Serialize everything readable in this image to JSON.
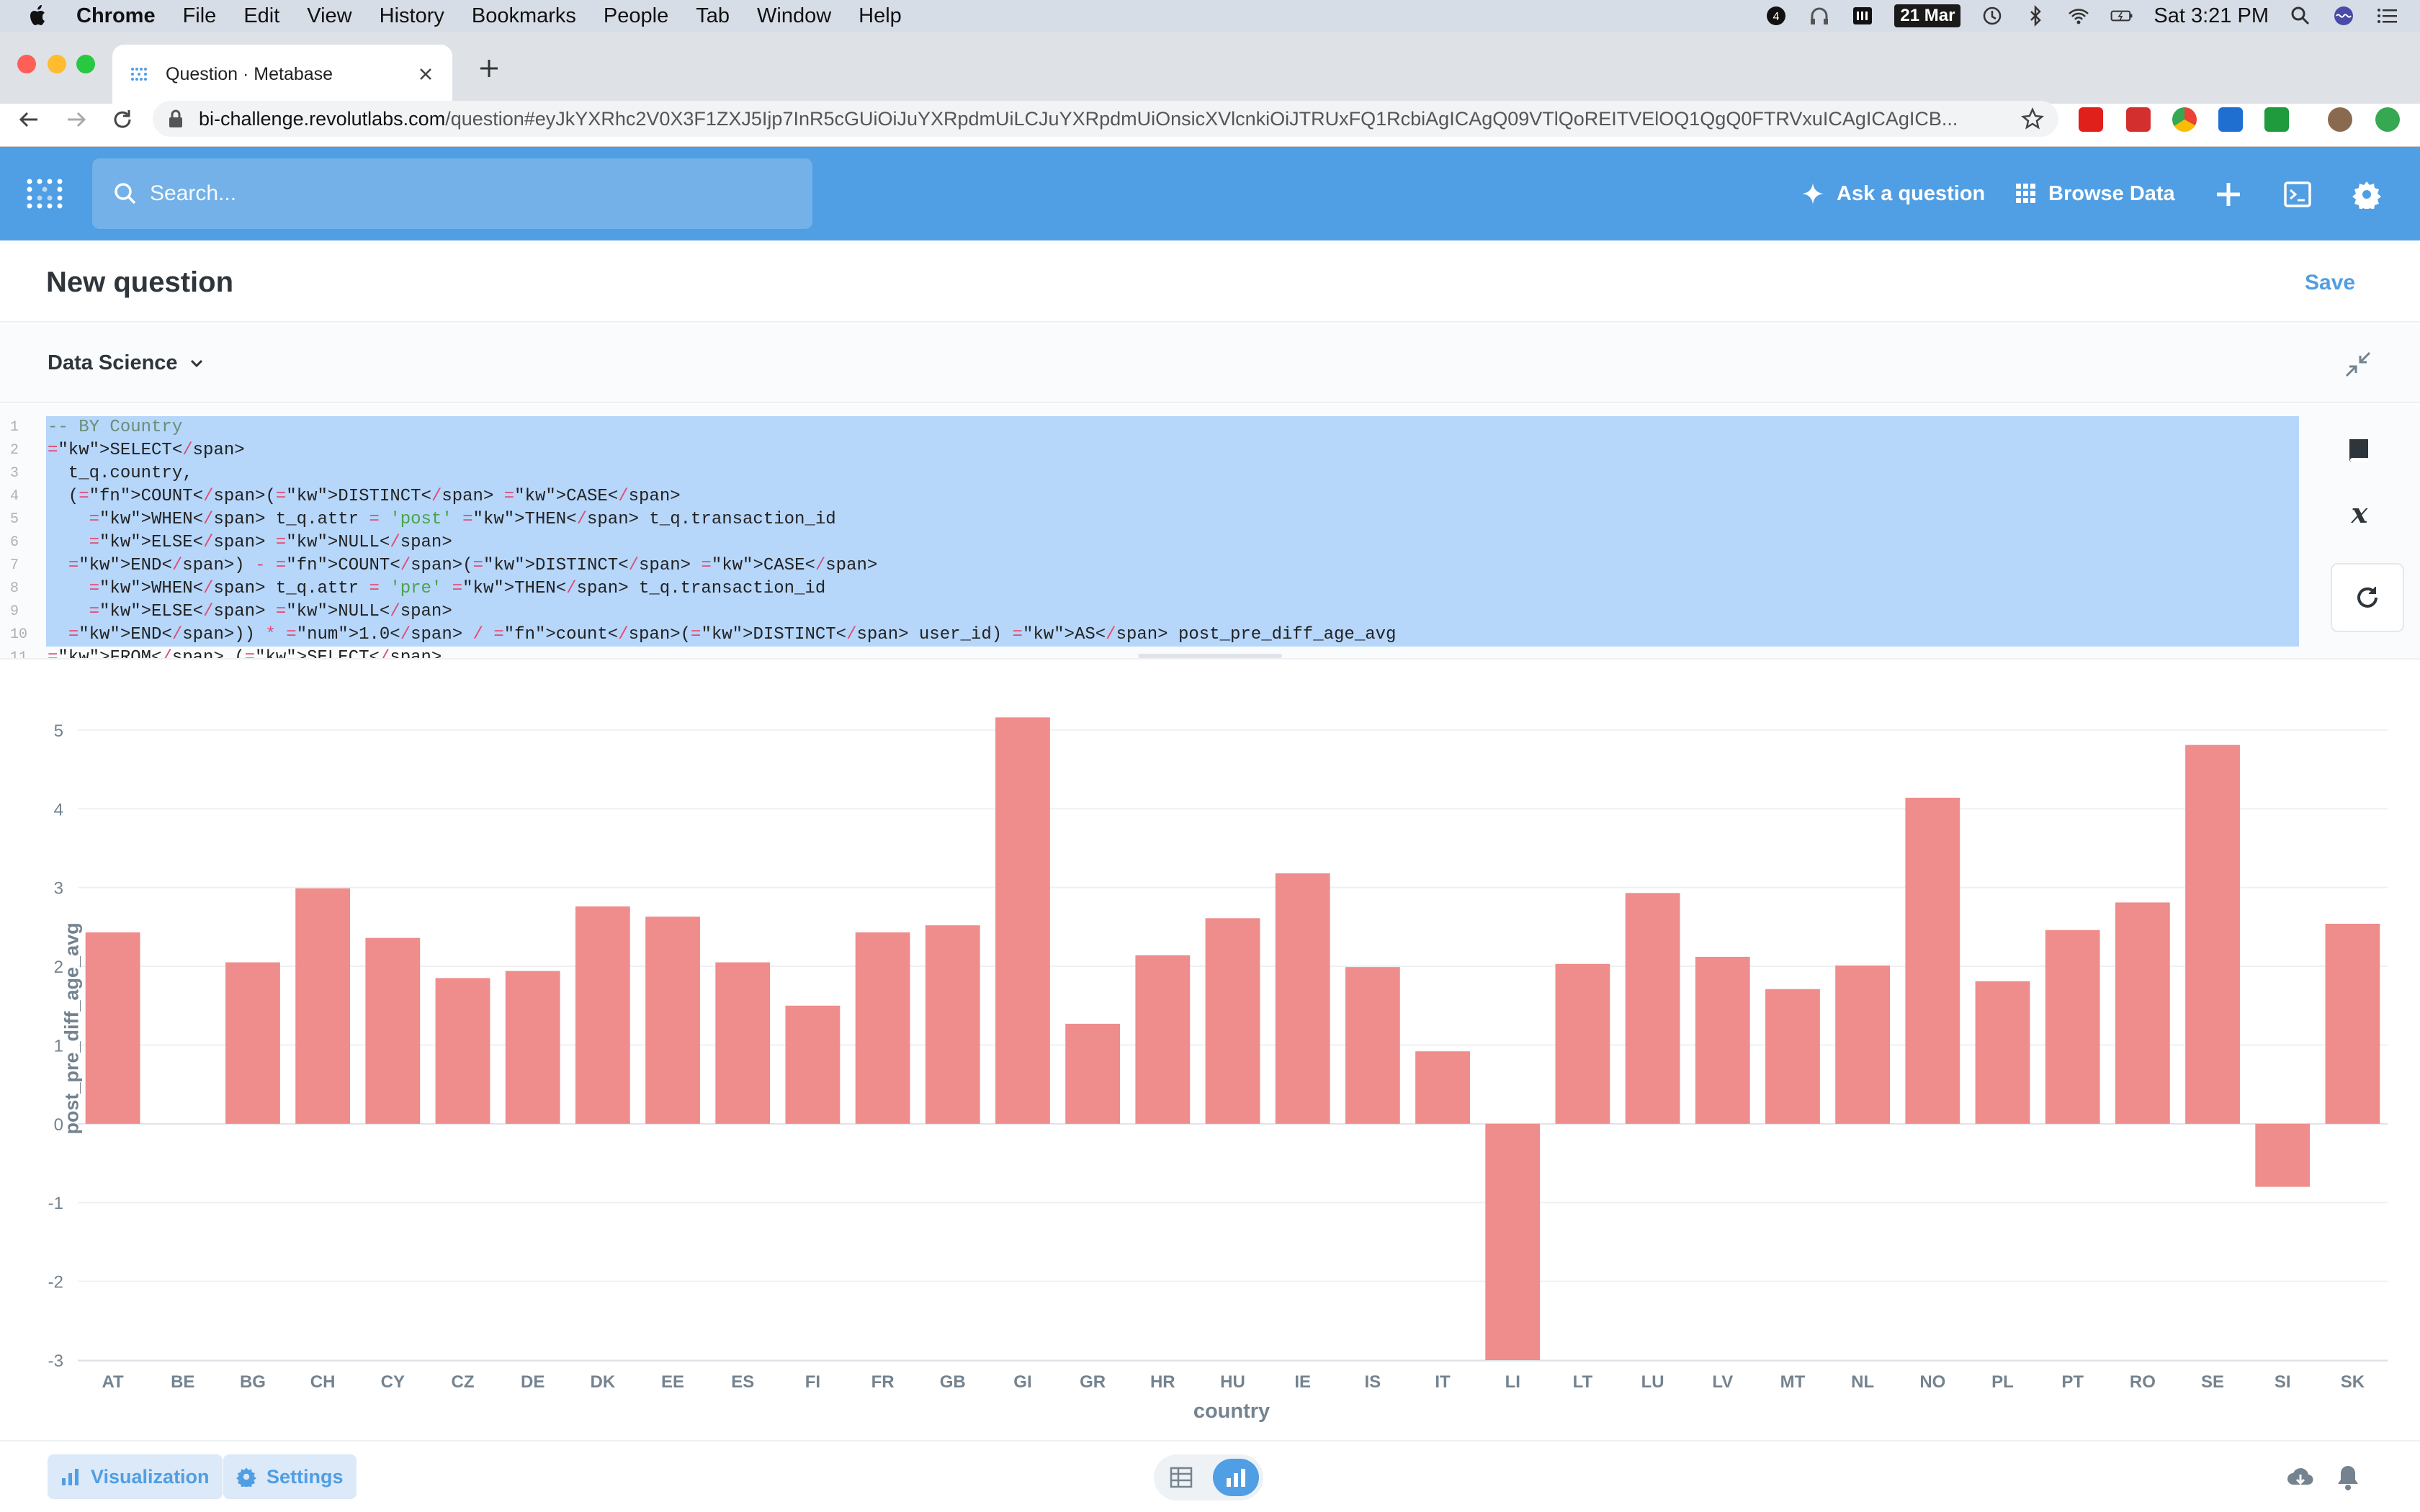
{
  "menubar": {
    "app": "Chrome",
    "items": [
      "File",
      "Edit",
      "View",
      "History",
      "Bookmarks",
      "People",
      "Tab",
      "Window",
      "Help"
    ],
    "date_badge": "21 Mar",
    "clock": "Sat 3:21 PM"
  },
  "browser": {
    "tab_title": "Question · Metabase",
    "url_host": "bi-challenge.revolutlabs.com",
    "url_path": "/question#eyJkYXRhc2V0X3F1ZXJ5Ijp7InR5cGUiOiJuYXRpdmUiLCJuYXRpdmUiOnsicXVlcnkiOiJTRUxFQ1RcbiAgICAgQ09VTlQoREITVElOQ1QgQ0FTRVxuICAgICAgICB..."
  },
  "navbar": {
    "search_placeholder": "Search...",
    "ask_question": "Ask a question",
    "browse_data": "Browse Data"
  },
  "question": {
    "title": "New question",
    "save_label": "Save",
    "database": "Data Science"
  },
  "editor": {
    "line_numbers": [
      "1",
      "2",
      "3",
      "4",
      "5",
      "6",
      "7",
      "8",
      "9",
      "10",
      "11"
    ],
    "lines": [
      "-- BY Country",
      "SELECT",
      "  t_q.country,",
      "  (COUNT(DISTINCT CASE",
      "    WHEN t_q.attr = 'post' THEN t_q.transaction_id",
      "    ELSE NULL",
      "  END) - COUNT(DISTINCT CASE",
      "    WHEN t_q.attr = 'pre' THEN t_q.transaction_id",
      "    ELSE NULL",
      "  END)) * 1.0 / count(DISTINCT user_id) AS post_pre_diff_age_avg",
      "FROM (SELECT"
    ]
  },
  "chart_data": {
    "type": "bar",
    "categories": [
      "AT",
      "BE",
      "BG",
      "CH",
      "CY",
      "CZ",
      "DE",
      "DK",
      "EE",
      "ES",
      "FI",
      "FR",
      "GB",
      "GI",
      "GR",
      "HR",
      "HU",
      "IE",
      "IS",
      "IT",
      "LI",
      "LT",
      "LU",
      "LV",
      "MT",
      "NL",
      "NO",
      "PL",
      "PT",
      "RO",
      "SE",
      "SI",
      "SK"
    ],
    "values": [
      2.43,
      0,
      2.05,
      2.99,
      2.36,
      1.85,
      1.94,
      2.76,
      2.63,
      2.05,
      1.5,
      2.43,
      2.52,
      5.16,
      1.27,
      2.14,
      2.61,
      3.18,
      1.99,
      0.92,
      -3.0,
      2.03,
      2.93,
      2.12,
      1.71,
      2.01,
      4.14,
      1.81,
      2.46,
      2.81,
      4.81,
      -0.8,
      2.54
    ],
    "xlabel": "country",
    "ylabel": "post_pre_diff_age_avg",
    "ylim": [
      -3,
      5.2
    ],
    "yticks": [
      "5",
      "4",
      "3",
      "2",
      "1",
      "0",
      "-1",
      "-2",
      "-3"
    ],
    "bar_color": "#ef8c8c",
    "grid": true
  },
  "footer": {
    "visualization_label": "Visualization",
    "settings_label": "Settings"
  },
  "colors": {
    "brand": "#509ee3",
    "selection": "#b6d6fa"
  }
}
